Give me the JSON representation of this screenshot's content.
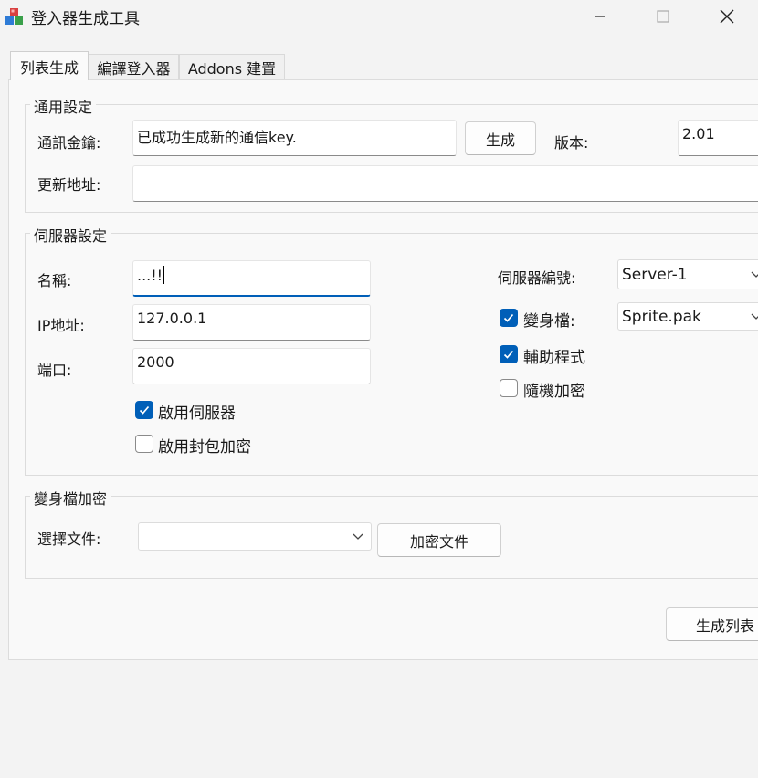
{
  "window": {
    "title": "登入器生成工具",
    "icon": "app-cubes-icon"
  },
  "tabs": [
    {
      "label": "列表生成",
      "active": true
    },
    {
      "label": "編譯登入器",
      "active": false
    },
    {
      "label": "Addons 建置",
      "active": false
    }
  ],
  "general": {
    "legend": "通用設定",
    "key_label": "通訊金鑰:",
    "key_value": "已成功生成新的通信key.",
    "generate_button": "生成",
    "version_label": "版本:",
    "version_value": "2.01",
    "update_label": "更新地址:",
    "update_value": ""
  },
  "server": {
    "legend": "伺服器設定",
    "name_label": "名稱:",
    "name_value": "...!!",
    "ip_label": "IP地址:",
    "ip_value": "127.0.0.1",
    "port_label": "端口:",
    "port_value": "2000",
    "enable_server_label": "啟用伺服器",
    "enable_server_checked": true,
    "packet_encrypt_label": "啟用封包加密",
    "packet_encrypt_checked": false,
    "server_no_label": "伺服器編號:",
    "server_no_value": "Server-1",
    "sprite_label": "變身檔:",
    "sprite_checked": true,
    "sprite_value": "Sprite.pak",
    "helper_label": "輔助程式",
    "helper_checked": true,
    "random_encrypt_label": "隨機加密",
    "random_encrypt_checked": false
  },
  "sprite_encrypt": {
    "legend": "變身檔加密",
    "select_label": "選擇文件:",
    "select_value": "",
    "encrypt_button": "加密文件"
  },
  "footer": {
    "generate_list_button": "生成列表"
  },
  "colors": {
    "accent": "#005fb8",
    "background": "#f3f3f3"
  }
}
